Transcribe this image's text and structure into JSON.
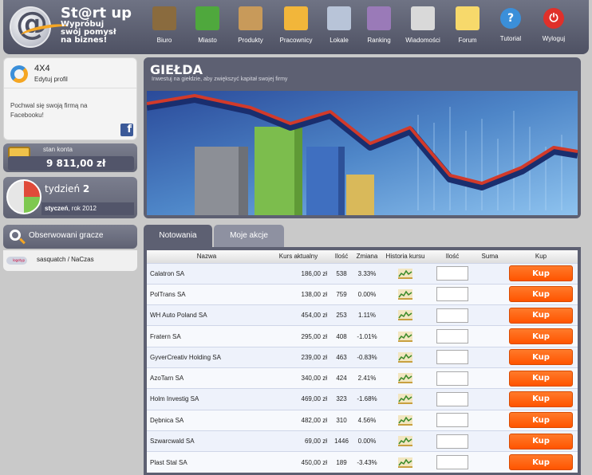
{
  "logo": {
    "title": "St@rt up",
    "subtitle": "Wypróbuj swój pomysł na biznes!"
  },
  "nav": [
    {
      "label": "Biuro",
      "icon": "desk-icon",
      "color": "#8a6b3e"
    },
    {
      "label": "Miasto",
      "icon": "map-icon",
      "color": "#4fa83d"
    },
    {
      "label": "Produkty",
      "icon": "boxes-icon",
      "color": "#c89a5a"
    },
    {
      "label": "Pracownicy",
      "icon": "folder-people-icon",
      "color": "#f2b63a"
    },
    {
      "label": "Lokale",
      "icon": "building-icon",
      "color": "#b8c4d8"
    },
    {
      "label": "Ranking",
      "icon": "chart-icon",
      "color": "#9a7ab8"
    },
    {
      "label": "Wiadomości",
      "icon": "envelope-icon",
      "color": "#d9d9d9"
    },
    {
      "label": "Forum",
      "icon": "speech-bubble-icon",
      "color": "#f7d96b"
    },
    {
      "label": "Tutorial",
      "icon": "question-icon",
      "color": "#3b8fd9"
    },
    {
      "label": "Wyloguj",
      "icon": "power-icon",
      "color": "#e0302a"
    }
  ],
  "profile": {
    "name": "4X4",
    "edit_label": "Edytuj profil",
    "facebook_text": "Pochwal się swoją firmą na Facebooku!"
  },
  "account": {
    "label": "stan konta",
    "value": "9 811,00 zł"
  },
  "week": {
    "prefix": "tydzień",
    "number": "2",
    "month": "styczeń",
    "year_text": ", rok 2012"
  },
  "observed": {
    "title": "Obserwowani gracze",
    "players": [
      {
        "name": "sasquatch / NaCzas",
        "logo_text": "logotyp"
      }
    ]
  },
  "banner": {
    "title": "GIEŁDA",
    "subtitle": "Inwestuj na giełdzie, aby zwiększyć kapitał swojej firmy"
  },
  "tabs": {
    "active": "Notowania",
    "inactive": "Moje akcje"
  },
  "table": {
    "headers": [
      "Nazwa",
      "Kurs aktualny",
      "Ilość",
      "Zmiana",
      "Historia kursu",
      "Ilość",
      "Suma",
      "Kup"
    ],
    "buy_label": "Kup",
    "rows": [
      {
        "name": "Calatron SA",
        "price": "186,00 zł",
        "qty": "538",
        "change": "3.33%"
      },
      {
        "name": "PolTrans SA",
        "price": "138,00 zł",
        "qty": "759",
        "change": "0.00%"
      },
      {
        "name": "WH Auto Poland SA",
        "price": "454,00 zł",
        "qty": "253",
        "change": "1.11%"
      },
      {
        "name": "Fratern SA",
        "price": "295,00 zł",
        "qty": "408",
        "change": "-1.01%"
      },
      {
        "name": "GyverCreativ Holding SA",
        "price": "239,00 zł",
        "qty": "463",
        "change": "-0.83%"
      },
      {
        "name": "AzoTarn SA",
        "price": "340,00 zł",
        "qty": "424",
        "change": "2.41%"
      },
      {
        "name": "Holm Investig SA",
        "price": "469,00 zł",
        "qty": "323",
        "change": "-1.68%"
      },
      {
        "name": "Dębnica SA",
        "price": "482,00 zł",
        "qty": "310",
        "change": "4.56%"
      },
      {
        "name": "Szwarcwald SA",
        "price": "69,00 zł",
        "qty": "1446",
        "change": "0.00%"
      },
      {
        "name": "Plast Stal SA",
        "price": "450,00 zł",
        "qty": "189",
        "change": "-3.43%"
      }
    ]
  }
}
